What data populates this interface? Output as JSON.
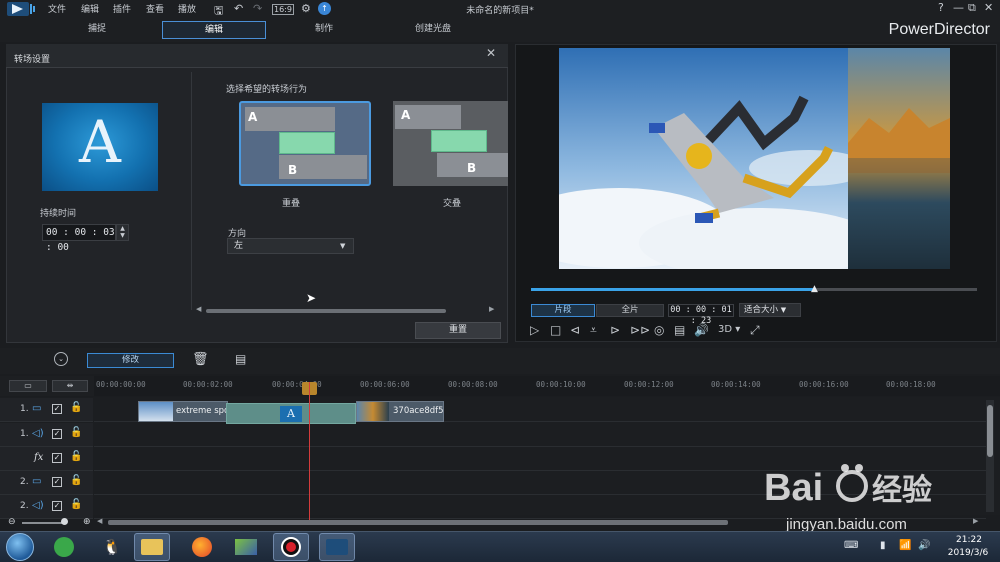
{
  "window": {
    "title": "未命名的新项目*",
    "brand": "PowerDirector",
    "menu": [
      "文件",
      "编辑",
      "插件",
      "查看",
      "播放"
    ],
    "toolbar_icons": [
      "save-icon",
      "undo-icon",
      "redo-icon",
      "aspect-ratio-icon",
      "settings-icon",
      "upgrade-icon"
    ],
    "win_controls": [
      "?",
      "—",
      "⧉",
      "✕"
    ]
  },
  "mode_tabs": [
    {
      "label": "捕捉",
      "active": false
    },
    {
      "label": "编辑",
      "active": true
    },
    {
      "label": "制作",
      "active": false
    },
    {
      "label": "创建光盘",
      "active": false
    }
  ],
  "transition_panel": {
    "title": "转场设置",
    "thumbnail_letter": "A",
    "duration_label": "持续时间",
    "duration_value": "00 : 00 : 03 : 00",
    "behavior_label": "选择希望的转场行为",
    "options": [
      {
        "caption": "重叠",
        "selected": true,
        "a": "A",
        "b": "B"
      },
      {
        "caption": "交叠",
        "selected": false,
        "a": "A",
        "b": "B"
      }
    ],
    "direction_label": "方向",
    "direction_value": "左",
    "reset_label": "重置"
  },
  "preview": {
    "scrub_position": 0.64,
    "clip_tab": "片段",
    "full_tab": "全片",
    "timecode": "00 : 00 : 01 : 23",
    "fit_select": "适合大小",
    "mode_3d": "3D"
  },
  "toolbar": {
    "modify_label": "修改"
  },
  "timeline": {
    "ticks": [
      "00:00:00:00",
      "00:00:02:00",
      "00:00:04:00",
      "00:00:06:00",
      "00:00:08:00",
      "00:00:10:00",
      "00:00:12:00",
      "00:00:14:00",
      "00:00:16:00",
      "00:00:18:00"
    ],
    "tracks": [
      {
        "num": "1.",
        "type": "video"
      },
      {
        "num": "1.",
        "type": "audio"
      },
      {
        "num": "",
        "type": "fx",
        "label": "fx"
      },
      {
        "num": "2.",
        "type": "video"
      },
      {
        "num": "2.",
        "type": "audio"
      }
    ],
    "clip1_label": "extreme spo",
    "clip2_label": "370ace8df5"
  },
  "taskbar": {
    "time": "21:22",
    "date": "2019/3/6"
  },
  "watermark": {
    "url": "jingyan.baidu.com"
  }
}
